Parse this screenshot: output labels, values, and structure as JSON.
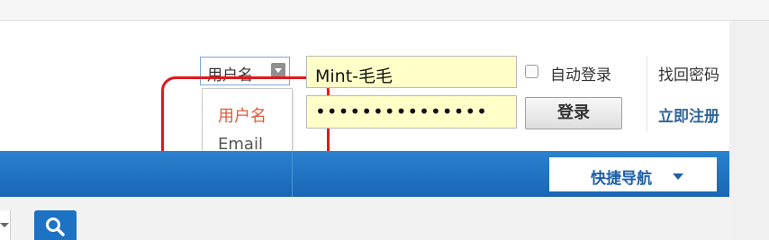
{
  "login": {
    "type_select_value": "用户名",
    "type_options": [
      "用户名",
      "Email"
    ],
    "username_value": "Mint-毛毛",
    "password_mask": "•••••••••••••••",
    "auto_login_label": "自动登录",
    "forgot_password": "找回密码",
    "register_now": "立即注册",
    "login_button": "登录"
  },
  "nav": {
    "quick_nav_label": "快捷导航"
  },
  "colors": {
    "nav_blue": "#1a66b4",
    "highlight_red": "#e0191e",
    "input_yellow": "#ffffc8"
  },
  "icons": {
    "search": "search-icon",
    "dropdown": "chevron-down-icon"
  }
}
